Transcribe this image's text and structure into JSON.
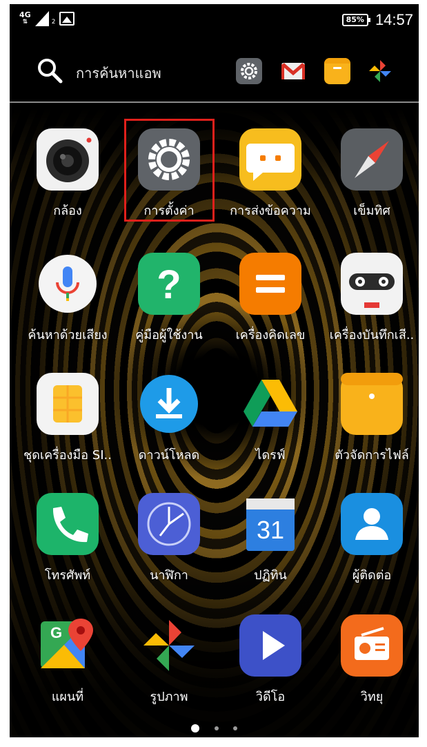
{
  "status_bar": {
    "network": "4G",
    "sim": "2",
    "battery": "85%",
    "time": "14:57"
  },
  "search": {
    "placeholder": "การค้นหาแอพ",
    "quick_apps": [
      "gear-icon",
      "gmail-icon",
      "file-manager-icon",
      "pinwheel-photos-icon"
    ]
  },
  "apps": [
    {
      "label": "กล้อง",
      "icon": "camera-icon"
    },
    {
      "label": "การตั้งค่า",
      "icon": "gear-icon"
    },
    {
      "label": "การส่งข้อความ",
      "icon": "messaging-icon"
    },
    {
      "label": "เข็มทิศ",
      "icon": "compass-icon"
    },
    {
      "label": "ค้นหาด้วยเสียง",
      "icon": "microphone-icon"
    },
    {
      "label": "คู่มือผู้ใช้งาน",
      "icon": "question-icon"
    },
    {
      "label": "เครื่องคิดเลข",
      "icon": "calculator-icon"
    },
    {
      "label": "เครื่องบันทึกเสี..",
      "icon": "recorder-icon"
    },
    {
      "label": "ชุดเครื่องมือ SI..",
      "icon": "sim-icon"
    },
    {
      "label": "ดาวน์โหลด",
      "icon": "download-icon"
    },
    {
      "label": "ไดรฟ์",
      "icon": "drive-icon"
    },
    {
      "label": "ตัวจัดการไฟล์",
      "icon": "file-manager-icon"
    },
    {
      "label": "โทรศัพท์",
      "icon": "phone-icon"
    },
    {
      "label": "นาฬิกา",
      "icon": "clock-icon"
    },
    {
      "label": "ปฏิทิน",
      "icon": "calendar-icon",
      "day": "31"
    },
    {
      "label": "ผู้ติดต่อ",
      "icon": "contacts-icon"
    },
    {
      "label": "แผนที่",
      "icon": "maps-icon"
    },
    {
      "label": "รูปภาพ",
      "icon": "photos-icon"
    },
    {
      "label": "วิดีโอ",
      "icon": "video-icon"
    },
    {
      "label": "วิทยุ",
      "icon": "radio-icon"
    }
  ],
  "colors": {
    "highlight": "#e0201b",
    "settings": "#5f6368",
    "messaging": "#f7bd1e",
    "help": "#21b46b",
    "calculator": "#f57c00",
    "download": "#1e9be8",
    "phone": "#1db46a",
    "clock": "#4c5fd5",
    "contacts": "#1a8fe0",
    "video": "#3d51c8",
    "radio": "#f36b1c"
  },
  "page_indicator": {
    "pages": 3,
    "current": 1
  }
}
